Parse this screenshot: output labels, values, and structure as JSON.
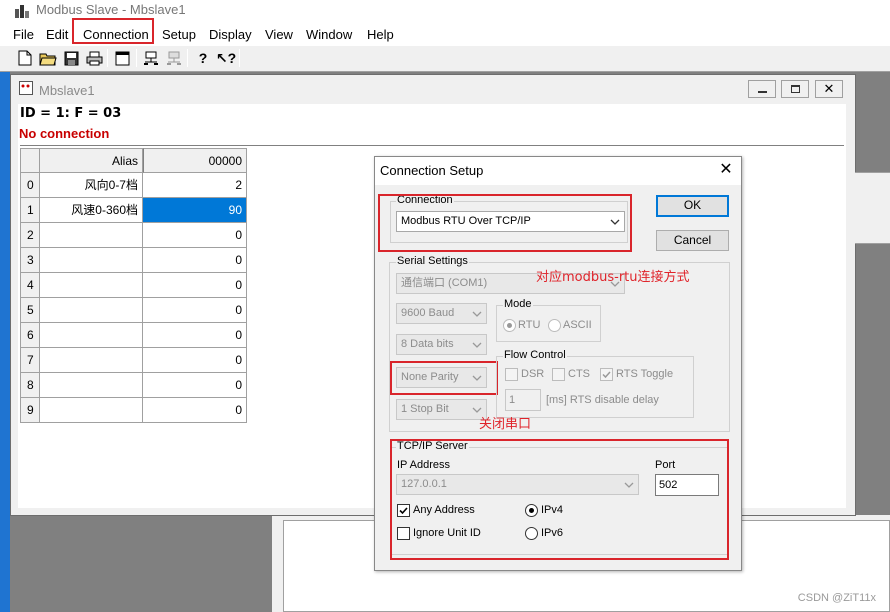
{
  "app": {
    "title": "Modbus Slave - Mbslave1",
    "menu": [
      "File",
      "Edit",
      "Connection",
      "Setup",
      "Display",
      "View",
      "Window",
      "Help"
    ],
    "accent_color": "#0078d7",
    "annotation_color": "#e0242b"
  },
  "child": {
    "title": "Mbslave1",
    "id_line": "ID = 1: F = 03",
    "status": "No connection",
    "grid": {
      "header_alias": "Alias",
      "header_col": "00000",
      "rows": [
        {
          "idx": "0",
          "alias": "风向0-7档",
          "value": "2"
        },
        {
          "idx": "1",
          "alias": "风速0-360档",
          "value": "90"
        },
        {
          "idx": "2",
          "alias": "",
          "value": "0"
        },
        {
          "idx": "3",
          "alias": "",
          "value": "0"
        },
        {
          "idx": "4",
          "alias": "",
          "value": "0"
        },
        {
          "idx": "5",
          "alias": "",
          "value": "0"
        },
        {
          "idx": "6",
          "alias": "",
          "value": "0"
        },
        {
          "idx": "7",
          "alias": "",
          "value": "0"
        },
        {
          "idx": "8",
          "alias": "",
          "value": "0"
        },
        {
          "idx": "9",
          "alias": "",
          "value": "0"
        }
      ]
    }
  },
  "dialog": {
    "title": "Connection Setup",
    "connection_label": "Connection",
    "connection_value": "Modbus RTU Over TCP/IP",
    "ok_label": "OK",
    "cancel_label": "Cancel",
    "serial_label": "Serial Settings",
    "port_value": "通信端口 (COM1)",
    "baud_value": "9600 Baud",
    "databits_value": "8 Data bits",
    "parity_value": "None Parity",
    "stopbit_value": "1 Stop Bit",
    "mode_label": "Mode",
    "mode_rtu": "RTU",
    "mode_ascii": "ASCII",
    "flow_label": "Flow Control",
    "flow_dsr": "DSR",
    "flow_cts": "CTS",
    "flow_rts": "RTS Toggle",
    "rts_delay_value": "1",
    "rts_delay_label": "[ms] RTS disable delay",
    "tcp_label": "TCP/IP Server",
    "ip_label": "IP Address",
    "ip_value": "127.0.0.1",
    "port_label": "Port",
    "port_number": "502",
    "any_address": "Any Address",
    "ignore_unit": "Ignore Unit ID",
    "ipv4": "IPv4",
    "ipv6": "IPv6"
  },
  "annotations": {
    "rtu_note": "对应modbus-rtu连接方式",
    "serial_note": "关闭串口"
  },
  "watermark": "CSDN @ZiT11x"
}
